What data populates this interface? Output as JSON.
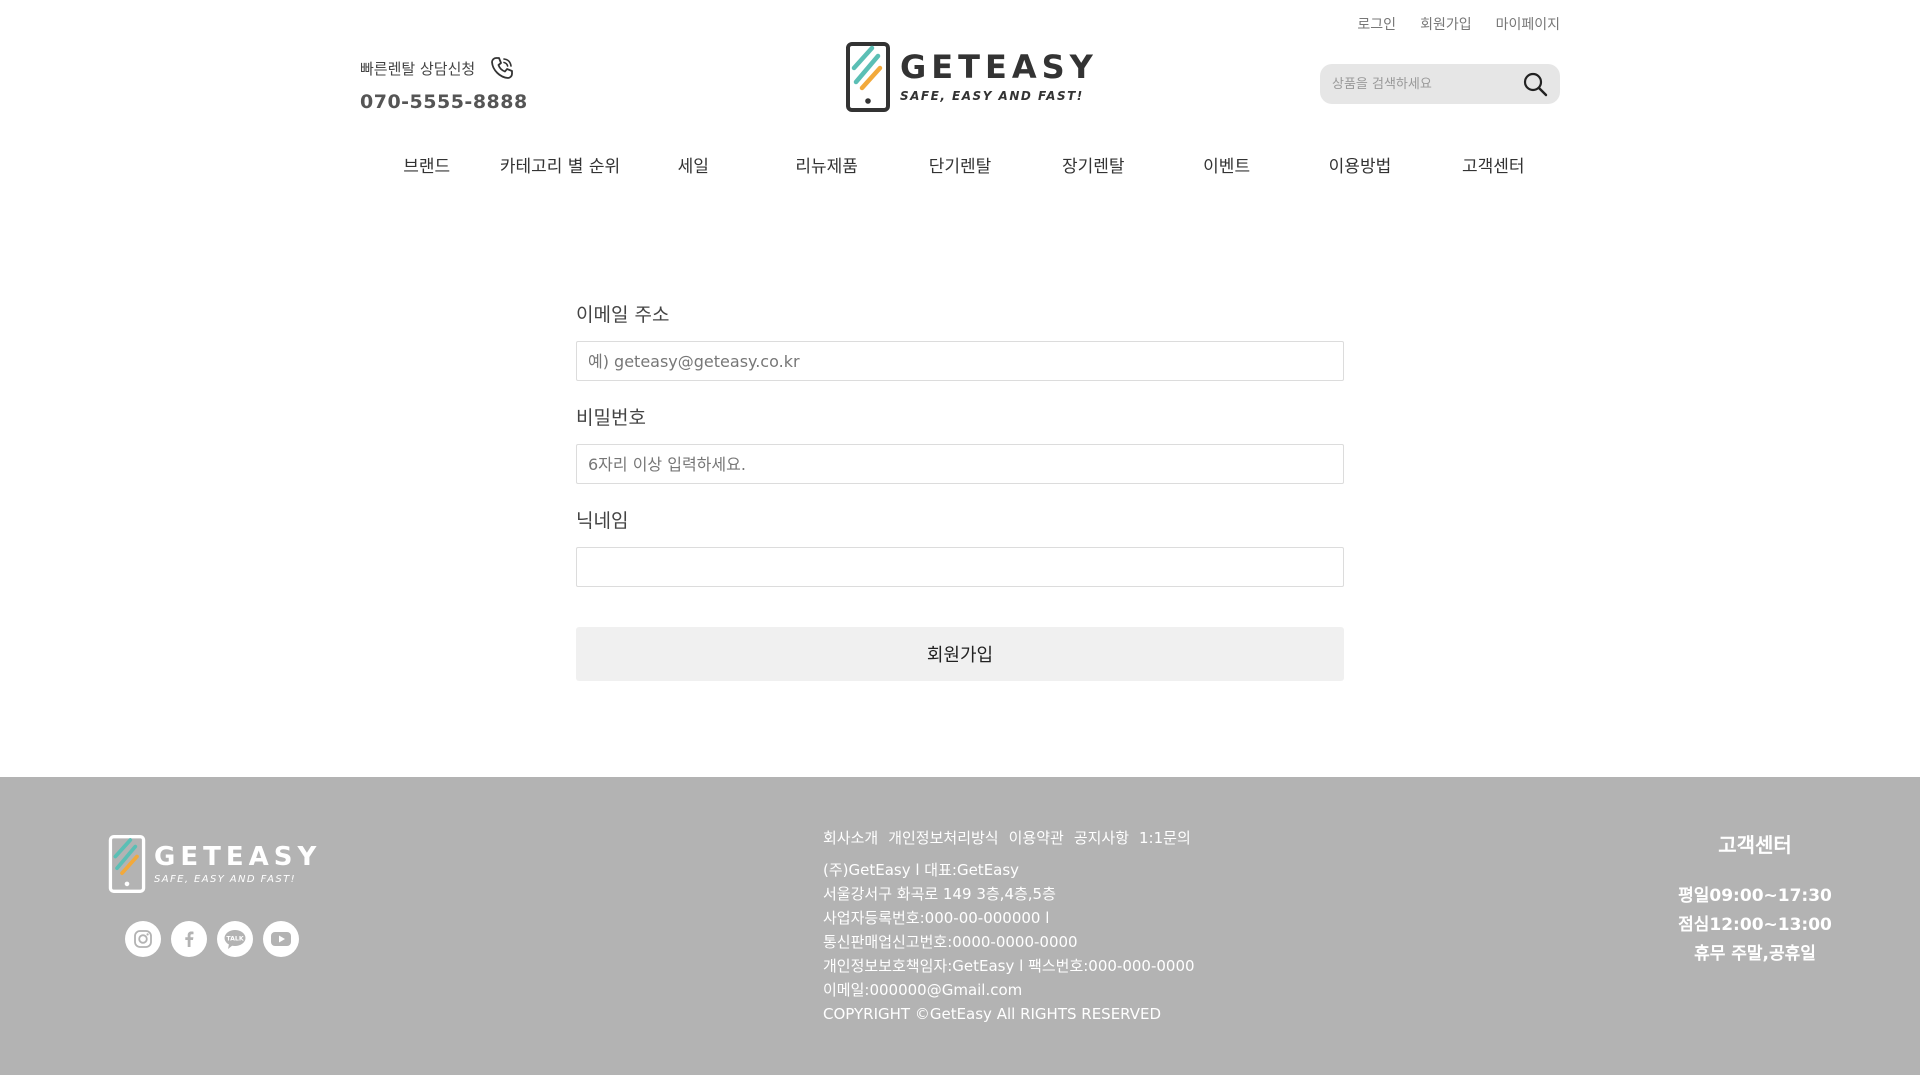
{
  "header": {
    "top_links": [
      "로그인",
      "회원가입",
      "마이페이지"
    ],
    "rental_label": "빠른렌탈 상담신청",
    "rental_phone": "070-5555-8888",
    "logo_name": "GETEASY",
    "logo_tagline": "SAFE, EASY AND FAST!",
    "search_placeholder": "상품을 검색하세요"
  },
  "nav": [
    "브랜드",
    "카테고리 별 순위",
    "세일",
    "리뉴제품",
    "단기렌탈",
    "장기렌탈",
    "이벤트",
    "이용방법",
    "고객센터"
  ],
  "form": {
    "email_label": "이메일 주소",
    "email_placeholder": "예) geteasy@geteasy.co.kr",
    "password_label": "비밀번호",
    "password_placeholder": "6자리 이상 입력하세요.",
    "nickname_label": "닉네임",
    "nickname_placeholder": "",
    "submit_label": "회원가입"
  },
  "footer": {
    "logo_name": "GETEASY",
    "logo_tagline": "SAFE, EASY AND FAST!",
    "social_icons": [
      "instagram-icon",
      "facebook-icon",
      "kakao-talk-icon",
      "youtube-icon"
    ],
    "talk_text": "TALK",
    "links": [
      "회사소개",
      "개인정보처리방식",
      "이용약관",
      "공지사항",
      "1:1문의"
    ],
    "info_lines": [
      "(주)GetEasy l 대표:GetEasy",
      "서울강서구 화곡로 149 3층,4층,5층",
      "사업자등록번호:000-00-000000 l",
      "통신판매업신고번호:0000-0000-0000",
      "개인정보보호책임자:GetEasy l 팩스번호:000-000-0000",
      "이메일:000000@Gmail.com",
      "COPYRIGHT ©GetEasy All RIGHTS RESERVED"
    ],
    "cs_title": "고객센터",
    "cs_lines": [
      "평일09:00~17:30",
      "점심12:00~13:00",
      "휴무 주말,공휴일"
    ]
  },
  "colors": {
    "footer_bg": "#b3b3b3",
    "logo_teal": "#5bbfb5",
    "logo_orange": "#f2a93b",
    "search_bg": "#e6e6e6",
    "button_bg": "#f0f0f0"
  }
}
